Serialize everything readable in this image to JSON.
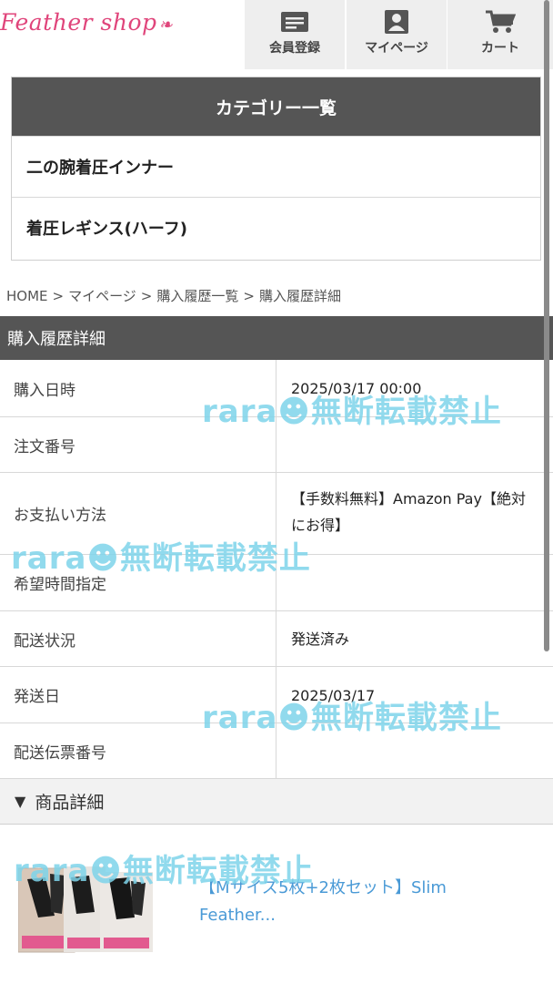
{
  "header": {
    "logo_text": "Feather shop",
    "buttons": [
      {
        "label": "会員登録",
        "icon": "member-card-icon"
      },
      {
        "label": "マイページ",
        "icon": "person-icon"
      },
      {
        "label": "カート",
        "icon": "cart-icon"
      }
    ]
  },
  "categories": {
    "title": "カテゴリー一覧",
    "items": [
      "二の腕着圧インナー",
      "着圧レギンス(ハーフ)"
    ]
  },
  "breadcrumb": [
    "HOME",
    "マイページ",
    "購入履歴一覧",
    "購入履歴詳細"
  ],
  "breadcrumb_sep": ">",
  "section_title": "購入履歴詳細",
  "details": [
    {
      "key": "購入日時",
      "value": "2025/03/17 00:00"
    },
    {
      "key": "注文番号",
      "value": ""
    },
    {
      "key": "お支払い方法",
      "value": "【手数料無料】Amazon Pay【絶対にお得】"
    },
    {
      "key": "希望時間指定",
      "value": ""
    },
    {
      "key": "配送状況",
      "value": "発送済み"
    },
    {
      "key": "発送日",
      "value": "2025/03/17"
    },
    {
      "key": "配送伝票番号",
      "value": ""
    }
  ],
  "product_section": {
    "title": "商品詳細",
    "toggle_symbol": "▼"
  },
  "product": {
    "title": "【Mサイズ5枚+2枚セット】Slim Feather..."
  },
  "watermark_text": "rara☻無断転載禁止",
  "colors": {
    "brand_pink": "#e0457b",
    "dark_header": "#555555",
    "link_blue": "#4a9ad6",
    "watermark": "#7ed4ea"
  }
}
